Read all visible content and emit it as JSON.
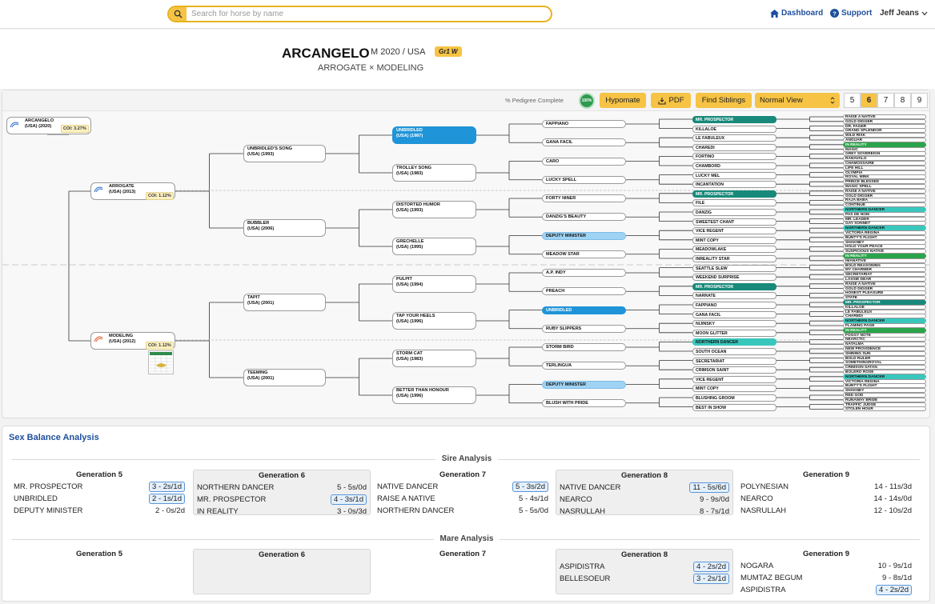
{
  "header": {
    "search_placeholder": "Search for horse by name",
    "dashboard": "Dashboard",
    "support": "Support",
    "user": "Jeff Jeans"
  },
  "horse": {
    "name": "ARCANGELO",
    "meta": "M 2020 / USA",
    "badge": "Gr1 W",
    "cross": "ARROGATE × MODELING"
  },
  "toolbar": {
    "pct_label": "% Pedigree Complete",
    "pct_value": "100%",
    "hypomate": "Hypomate",
    "pdf": "PDF",
    "siblings": "Find Siblings",
    "view": "Normal View",
    "gens": [
      "5",
      "6",
      "7",
      "8",
      "9"
    ],
    "active_gen": "6"
  },
  "pedigree": {
    "subject": {
      "l1": "ARCANGELO",
      "l2": "(USA) (2020)",
      "coi": "COI: 3.27%"
    },
    "g1": [
      {
        "l1": "ARROGATE",
        "l2": "(USA) (2013)",
        "coi": "COI: 1.12%"
      },
      {
        "l1": "MODELING",
        "l2": "(USA) (2012)",
        "coi": "COI: 1.12%"
      }
    ],
    "g2": [
      {
        "l1": "UNBRIDLED'S SONG",
        "l2": "(USA) (1993)"
      },
      {
        "l1": "BUBBLER",
        "l2": "(USA) (2006)"
      },
      {
        "l1": "TAPIT",
        "l2": "(USA) (2001)"
      },
      {
        "l1": "TEEMING",
        "l2": "(USA) (2001)"
      }
    ],
    "g3": [
      {
        "l1": "UNBRIDLED",
        "l2": "(USA) (1987)",
        "c": "blue"
      },
      {
        "l1": "TROLLEY SONG",
        "l2": "(USA) (1983)"
      },
      {
        "l1": "DISTORTED HUMOR",
        "l2": "(USA) (1993)"
      },
      {
        "l1": "GRECHELLE",
        "l2": "(USA) (1995)"
      },
      {
        "l1": "PULPIT",
        "l2": "(USA) (1994)"
      },
      {
        "l1": "TAP YOUR HEELS",
        "l2": "(USA) (1996)"
      },
      {
        "l1": "STORM CAT",
        "l2": "(USA) (1983)"
      },
      {
        "l1": "BETTER THAN HONOUR",
        "l2": "(USA) (1996)"
      }
    ],
    "g4": [
      {
        "t": "FAPPIANO"
      },
      {
        "t": "GANA FACIL"
      },
      {
        "t": "CARO"
      },
      {
        "t": "LUCKY SPELL"
      },
      {
        "t": "FORTY NINER"
      },
      {
        "t": "DANZIG'S BEAUTY"
      },
      {
        "t": "DEPUTY MINISTER",
        "c": "lblue"
      },
      {
        "t": "MEADOW STAR"
      },
      {
        "t": "A.P. INDY"
      },
      {
        "t": "PREACH"
      },
      {
        "t": "UNBRIDLED",
        "c": "blue"
      },
      {
        "t": "RUBY SLIPPERS"
      },
      {
        "t": "STORM BIRD"
      },
      {
        "t": "TERLINGUA"
      },
      {
        "t": "DEPUTY MINISTER",
        "c": "lblue"
      },
      {
        "t": "BLUSH WITH PRIDE"
      }
    ],
    "g5": [
      {
        "t": "MR. PROSPECTOR",
        "c": "teal"
      },
      {
        "t": "KILLALOE"
      },
      {
        "t": "LE FABULEUX"
      },
      {
        "t": "CHAREDI"
      },
      {
        "t": "FORTINO"
      },
      {
        "t": "CHAMBORD"
      },
      {
        "t": "LUCKY MEL"
      },
      {
        "t": "INCANTATION"
      },
      {
        "t": "MR. PROSPECTOR",
        "c": "teal"
      },
      {
        "t": "FILE"
      },
      {
        "t": "DANZIG"
      },
      {
        "t": "SWEETEST CHANT"
      },
      {
        "t": "VICE REGENT"
      },
      {
        "t": "MINT COPY"
      },
      {
        "t": "MEADOWLAKE"
      },
      {
        "t": "INREALITY STAR"
      },
      {
        "t": "SEATTLE SLEW"
      },
      {
        "t": "WEEKEND SURPRISE"
      },
      {
        "t": "MR. PROSPECTOR",
        "c": "teal"
      },
      {
        "t": "NARRATE"
      },
      {
        "t": "FAPPIANO"
      },
      {
        "t": "GANA FACIL"
      },
      {
        "t": "NIJINSKY"
      },
      {
        "t": "MOON GLITTER"
      },
      {
        "t": "NORTHERN DANCER",
        "c": "lteal"
      },
      {
        "t": "SOUTH OCEAN"
      },
      {
        "t": "SECRETARIAT"
      },
      {
        "t": "CRIMSON SAINT"
      },
      {
        "t": "VICE REGENT"
      },
      {
        "t": "MINT COPY"
      },
      {
        "t": "BLUSHING GROOM"
      },
      {
        "t": "BEST IN SHOW"
      }
    ],
    "g6": [
      {
        "t": "RAISE A NATIVE"
      },
      {
        "t": "GOLD DIGGER"
      },
      {
        "t": "DR. FAGER"
      },
      {
        "t": "GRAND SPLENDOR"
      },
      {
        "t": "WILD RISK"
      },
      {
        "t": "ANGUAR"
      },
      {
        "t": "IN REALITY",
        "c": "green"
      },
      {
        "t": "MAGIC"
      },
      {
        "t": "GREY SOVEREIGN"
      },
      {
        "t": "RANAVALO"
      },
      {
        "t": "CHAMOSSAIRE"
      },
      {
        "t": "LIFE HILL"
      },
      {
        "t": "OLYMPIA"
      },
      {
        "t": "ROYAL MINK"
      },
      {
        "t": "PRINCE BLESSED"
      },
      {
        "t": "MAGIC SPELL"
      },
      {
        "t": "RAISE A NATIVE"
      },
      {
        "t": "GOLD DIGGER"
      },
      {
        "t": "RAJA BABA"
      },
      {
        "t": "CONTINUE"
      },
      {
        "t": "NORTHERN DANCER",
        "c": "lteal"
      },
      {
        "t": "PAS DE NOM"
      },
      {
        "t": "MR. LEADER"
      },
      {
        "t": "GAY SONNET"
      },
      {
        "t": "NORTHERN DANCER",
        "c": "lteal"
      },
      {
        "t": "VICTORIA REGINA"
      },
      {
        "t": "BUNTY'S FLIGHT"
      },
      {
        "t": "SHAKNEY"
      },
      {
        "t": "HOLD YOUR PEACE"
      },
      {
        "t": "SUSPICIOUS NATIVE"
      },
      {
        "t": "IN REALITY",
        "c": "green"
      },
      {
        "t": "IMANATIVE"
      },
      {
        "t": "BOLD REASONING"
      },
      {
        "t": "MY CHARMER"
      },
      {
        "t": "SECRETARIAT"
      },
      {
        "t": "LASSIE DEAR"
      },
      {
        "t": "RAISE A NATIVE"
      },
      {
        "t": "GOLD DIGGER"
      },
      {
        "t": "HONEST PLEASURE"
      },
      {
        "t": "STATE"
      },
      {
        "t": "MR. PROSPECTOR",
        "c": "teal"
      },
      {
        "t": "KILLALOE"
      },
      {
        "t": "LE FABULEUX"
      },
      {
        "t": "CHAREDI"
      },
      {
        "t": "NORTHERN DANCER",
        "c": "lteal"
      },
      {
        "t": "FLAMING PAGE"
      },
      {
        "t": "IN REALITY",
        "c": "green"
      },
      {
        "t": "FOGGY NOTE"
      },
      {
        "t": "NEARCTIC"
      },
      {
        "t": "NATALMA"
      },
      {
        "t": "NEW PROVIDENCE"
      },
      {
        "t": "SHINING SUN"
      },
      {
        "t": "BOLD RULER"
      },
      {
        "t": "SOMETHINGROYAL"
      },
      {
        "t": "CRIMSON SATAN"
      },
      {
        "t": "BOLERO ROSE"
      },
      {
        "t": "NORTHERN DANCER",
        "c": "lteal"
      },
      {
        "t": "VICTORIA REGINA"
      },
      {
        "t": "BUNTY'S FLIGHT"
      },
      {
        "t": "SHAKNEY"
      },
      {
        "t": "RED GOD"
      },
      {
        "t": "RUNAWAY BRIDE"
      },
      {
        "t": "TRAFFIC JUDGE"
      },
      {
        "t": "STOLEN HOUR"
      }
    ]
  },
  "sex_balance": {
    "title": "Sex Balance Analysis",
    "sire_label": "Sire Analysis",
    "mare_label": "Mare Analysis",
    "sire": [
      {
        "gen": "Generation 5",
        "rows": [
          {
            "name": "MR. PROSPECTOR",
            "val": "3 - 2s/1d",
            "hl": true
          },
          {
            "name": "UNBRIDLED",
            "val": "2 - 1s/1d",
            "hl": true
          },
          {
            "name": "DEPUTY MINISTER",
            "val": "2 - 0s/2d",
            "hl": false
          }
        ]
      },
      {
        "gen": "Generation 6",
        "rows": [
          {
            "name": "NORTHERN DANCER",
            "val": "5 - 5s/0d",
            "hl": false
          },
          {
            "name": "MR. PROSPECTOR",
            "val": "4 - 3s/1d",
            "hl": true
          },
          {
            "name": "IN REALITY",
            "val": "3 - 0s/3d",
            "hl": false
          }
        ]
      },
      {
        "gen": "Generation 7",
        "rows": [
          {
            "name": "NATIVE DANCER",
            "val": "5 - 3s/2d",
            "hl": true
          },
          {
            "name": "RAISE A NATIVE",
            "val": "5 - 4s/1d",
            "hl": false
          },
          {
            "name": "NORTHERN DANCER",
            "val": "5 - 5s/0d",
            "hl": false
          }
        ]
      },
      {
        "gen": "Generation 8",
        "rows": [
          {
            "name": "NATIVE DANCER",
            "val": "11 - 5s/6d",
            "hl": true
          },
          {
            "name": "NEARCO",
            "val": "9 - 9s/0d",
            "hl": false
          },
          {
            "name": "NASRULLAH",
            "val": "8 - 7s/1d",
            "hl": false
          }
        ]
      },
      {
        "gen": "Generation 9",
        "rows": [
          {
            "name": "POLYNESIAN",
            "val": "14 - 11s/3d",
            "hl": false
          },
          {
            "name": "NEARCO",
            "val": "14 - 14s/0d",
            "hl": false
          },
          {
            "name": "NASRULLAH",
            "val": "12 - 10s/2d",
            "hl": false
          }
        ]
      }
    ],
    "mare": [
      {
        "gen": "Generation 5",
        "rows": []
      },
      {
        "gen": "Generation 6",
        "rows": []
      },
      {
        "gen": "Generation 7",
        "rows": []
      },
      {
        "gen": "Generation 8",
        "rows": [
          {
            "name": "ASPIDISTRA",
            "val": "4 - 2s/2d",
            "hl": true
          },
          {
            "name": "BELLESOEUR",
            "val": "3 - 2s/1d",
            "hl": true
          }
        ]
      },
      {
        "gen": "Generation 9",
        "rows": [
          {
            "name": "NOGARA",
            "val": "10 - 9s/1d",
            "hl": false
          },
          {
            "name": "MUMTAZ BEGUM",
            "val": "9 - 8s/1d",
            "hl": false
          },
          {
            "name": "ASPIDISTRA",
            "val": "4 - 2s/2d",
            "hl": true
          }
        ]
      }
    ]
  }
}
